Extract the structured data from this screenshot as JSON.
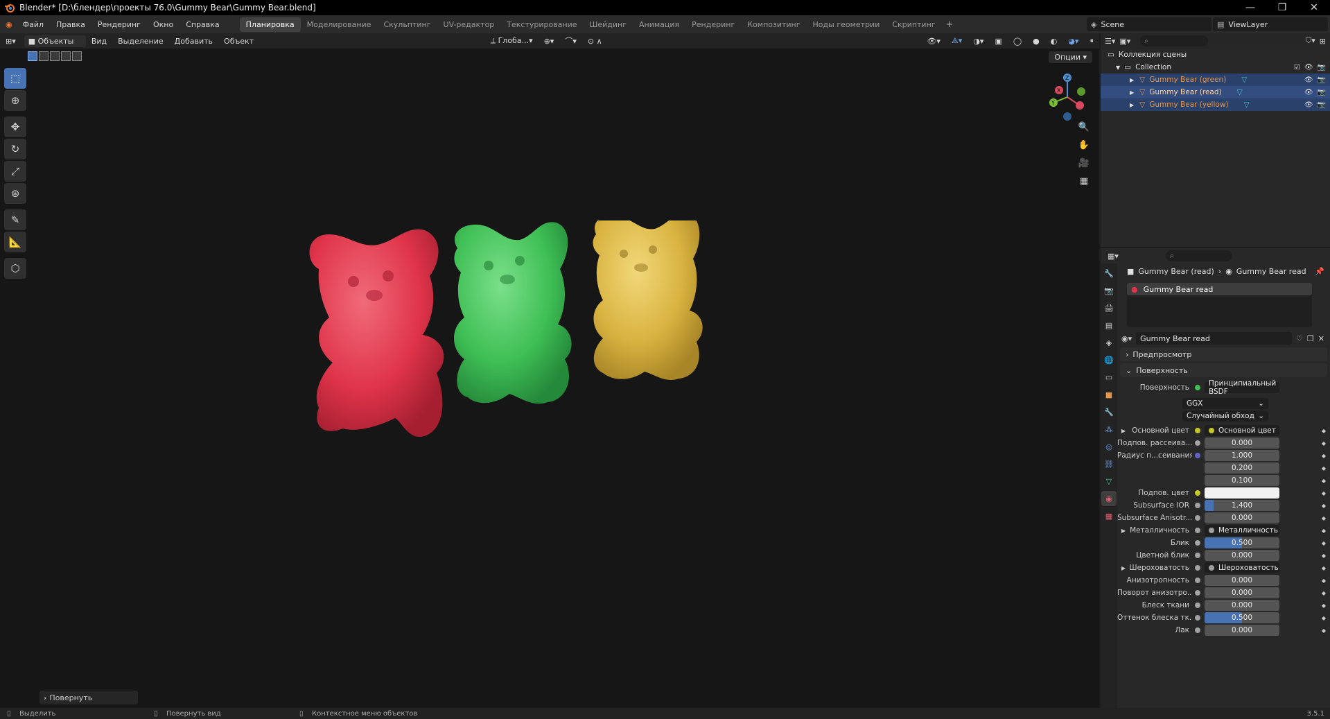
{
  "window": {
    "title": "Blender* [D:\\блендер\\проекты 76.0\\Gummy Bear\\Gummy Bear.blend]",
    "controls": [
      "—",
      "❐",
      "✕"
    ]
  },
  "menu": [
    "Файл",
    "Правка",
    "Рендеринг",
    "Окно",
    "Справка"
  ],
  "workspaces": [
    {
      "label": "Планировка",
      "active": true
    },
    {
      "label": "Моделирование",
      "active": false
    },
    {
      "label": "Скульптинг",
      "active": false
    },
    {
      "label": "UV-редактор",
      "active": false
    },
    {
      "label": "Текстурирование",
      "active": false
    },
    {
      "label": "Шейдинг",
      "active": false
    },
    {
      "label": "Анимация",
      "active": false
    },
    {
      "label": "Рендеринг",
      "active": false
    },
    {
      "label": "Композитинг",
      "active": false
    },
    {
      "label": "Ноды геометрии",
      "active": false
    },
    {
      "label": "Скриптинг",
      "active": false
    }
  ],
  "scene": {
    "name": "Scene",
    "view_layer": "ViewLayer"
  },
  "viewport": {
    "mode": "Объекты",
    "menu": [
      "Вид",
      "Выделение",
      "Добавить",
      "Объект"
    ],
    "transform_orientation": "Глоба...",
    "options_label": "Опции",
    "last_operation": "Повернуть",
    "bears": [
      {
        "name": "red",
        "color": "#e0344a"
      },
      {
        "name": "green",
        "color": "#3fbf55"
      },
      {
        "name": "yellow",
        "color": "#d9b340"
      }
    ]
  },
  "tools": [
    "select-box",
    "cursor",
    "move",
    "rotate",
    "scale",
    "transform",
    "annotate",
    "measure",
    "add-cube"
  ],
  "outliner": {
    "root": "Коллекция сцены",
    "collection": "Collection",
    "objects": [
      {
        "label": "Gummy Bear (green)",
        "selected": true
      },
      {
        "label": "Gummy Bear (read)",
        "selected": true
      },
      {
        "label": "Gummy Bear (yellow)",
        "selected": true
      }
    ]
  },
  "properties": {
    "breadcrumb_object": "Gummy Bear (read)",
    "breadcrumb_material": "Gummy Bear read",
    "material_slot": "Gummy Bear read",
    "material_name": "Gummy Bear read",
    "panels": {
      "preview": "Предпросмотр",
      "surface": "Поверхность"
    },
    "surface_label": "Поверхность",
    "surface_value": "Принципиальный BSDF",
    "distribution": "GGX",
    "subsurface_method": "Случайный обход",
    "rows": [
      {
        "label": "Основной цвет",
        "type": "socket",
        "value": "Основной цвет",
        "dot": "#c7c729",
        "expand": true
      },
      {
        "label": "Подпов. рассеива...",
        "type": "num",
        "value": "0.000",
        "dot": "#a1a1a1",
        "fill": 0
      },
      {
        "label": "Радиус п...сеивания",
        "type": "num",
        "value": "1.000",
        "dot": "#6363c7",
        "fill": 0
      },
      {
        "label": "",
        "type": "num",
        "value": "0.200",
        "dot": "",
        "fill": 0
      },
      {
        "label": "",
        "type": "num",
        "value": "0.100",
        "dot": "",
        "fill": 0
      },
      {
        "label": "Подпов. цвет",
        "type": "color",
        "value": "",
        "dot": "#c7c729",
        "color": "#f2f2f2"
      },
      {
        "label": "Subsurface IOR",
        "type": "num",
        "value": "1.400",
        "dot": "#a1a1a1",
        "fill": 0.12
      },
      {
        "label": "Subsurface Anisotr...",
        "type": "num",
        "value": "0.000",
        "dot": "#a1a1a1",
        "fill": 0
      },
      {
        "label": "Металличность",
        "type": "socket",
        "value": "Металличность",
        "dot": "#a1a1a1",
        "expand": true
      },
      {
        "label": "Блик",
        "type": "num",
        "value": "0.500",
        "dot": "#a1a1a1",
        "fill": 0.5
      },
      {
        "label": "Цветной блик",
        "type": "num",
        "value": "0.000",
        "dot": "#a1a1a1",
        "fill": 0
      },
      {
        "label": "Шероховатость",
        "type": "socket",
        "value": "Шероховатость",
        "dot": "#a1a1a1",
        "expand": true
      },
      {
        "label": "Анизотропность",
        "type": "num",
        "value": "0.000",
        "dot": "#a1a1a1",
        "fill": 0
      },
      {
        "label": "Поворот анизотро...",
        "type": "num",
        "value": "0.000",
        "dot": "#a1a1a1",
        "fill": 0
      },
      {
        "label": "Блеск ткани",
        "type": "num",
        "value": "0.000",
        "dot": "#a1a1a1",
        "fill": 0
      },
      {
        "label": "Оттенок блеска тк...",
        "type": "num",
        "value": "0.500",
        "dot": "#a1a1a1",
        "fill": 0.5
      },
      {
        "label": "Лак",
        "type": "num",
        "value": "0.000",
        "dot": "#a1a1a1",
        "fill": 0
      }
    ]
  },
  "statusbar": {
    "left": "Выделить",
    "middle": "Повернуть вид",
    "right": "Контекстное меню объектов",
    "version": "3.5.1"
  }
}
